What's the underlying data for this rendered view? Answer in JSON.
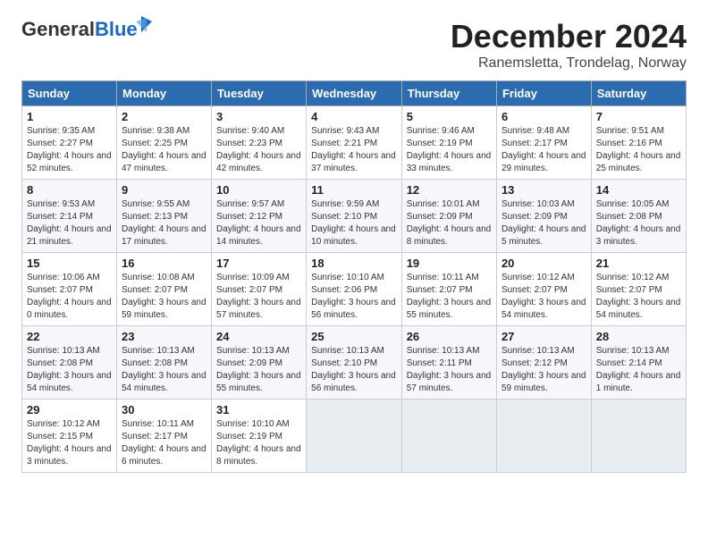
{
  "header": {
    "logo_line1": "General",
    "logo_line2": "Blue",
    "title": "December 2024",
    "subtitle": "Ranemsletta, Trondelag, Norway"
  },
  "calendar": {
    "days_of_week": [
      "Sunday",
      "Monday",
      "Tuesday",
      "Wednesday",
      "Thursday",
      "Friday",
      "Saturday"
    ],
    "weeks": [
      [
        {
          "day": "",
          "info": ""
        },
        {
          "day": "2",
          "info": "Sunrise: 9:38 AM\nSunset: 2:25 PM\nDaylight: 4 hours\nand 47 minutes."
        },
        {
          "day": "3",
          "info": "Sunrise: 9:40 AM\nSunset: 2:23 PM\nDaylight: 4 hours\nand 42 minutes."
        },
        {
          "day": "4",
          "info": "Sunrise: 9:43 AM\nSunset: 2:21 PM\nDaylight: 4 hours\nand 37 minutes."
        },
        {
          "day": "5",
          "info": "Sunrise: 9:46 AM\nSunset: 2:19 PM\nDaylight: 4 hours\nand 33 minutes."
        },
        {
          "day": "6",
          "info": "Sunrise: 9:48 AM\nSunset: 2:17 PM\nDaylight: 4 hours\nand 29 minutes."
        },
        {
          "day": "7",
          "info": "Sunrise: 9:51 AM\nSunset: 2:16 PM\nDaylight: 4 hours\nand 25 minutes."
        }
      ],
      [
        {
          "day": "8",
          "info": "Sunrise: 9:53 AM\nSunset: 2:14 PM\nDaylight: 4 hours\nand 21 minutes."
        },
        {
          "day": "9",
          "info": "Sunrise: 9:55 AM\nSunset: 2:13 PM\nDaylight: 4 hours\nand 17 minutes."
        },
        {
          "day": "10",
          "info": "Sunrise: 9:57 AM\nSunset: 2:12 PM\nDaylight: 4 hours\nand 14 minutes."
        },
        {
          "day": "11",
          "info": "Sunrise: 9:59 AM\nSunset: 2:10 PM\nDaylight: 4 hours\nand 10 minutes."
        },
        {
          "day": "12",
          "info": "Sunrise: 10:01 AM\nSunset: 2:09 PM\nDaylight: 4 hours\nand 8 minutes."
        },
        {
          "day": "13",
          "info": "Sunrise: 10:03 AM\nSunset: 2:09 PM\nDaylight: 4 hours\nand 5 minutes."
        },
        {
          "day": "14",
          "info": "Sunrise: 10:05 AM\nSunset: 2:08 PM\nDaylight: 4 hours\nand 3 minutes."
        }
      ],
      [
        {
          "day": "15",
          "info": "Sunrise: 10:06 AM\nSunset: 2:07 PM\nDaylight: 4 hours\nand 0 minutes."
        },
        {
          "day": "16",
          "info": "Sunrise: 10:08 AM\nSunset: 2:07 PM\nDaylight: 3 hours\nand 59 minutes."
        },
        {
          "day": "17",
          "info": "Sunrise: 10:09 AM\nSunset: 2:07 PM\nDaylight: 3 hours\nand 57 minutes."
        },
        {
          "day": "18",
          "info": "Sunrise: 10:10 AM\nSunset: 2:06 PM\nDaylight: 3 hours\nand 56 minutes."
        },
        {
          "day": "19",
          "info": "Sunrise: 10:11 AM\nSunset: 2:07 PM\nDaylight: 3 hours\nand 55 minutes."
        },
        {
          "day": "20",
          "info": "Sunrise: 10:12 AM\nSunset: 2:07 PM\nDaylight: 3 hours\nand 54 minutes."
        },
        {
          "day": "21",
          "info": "Sunrise: 10:12 AM\nSunset: 2:07 PM\nDaylight: 3 hours\nand 54 minutes."
        }
      ],
      [
        {
          "day": "22",
          "info": "Sunrise: 10:13 AM\nSunset: 2:08 PM\nDaylight: 3 hours\nand 54 minutes."
        },
        {
          "day": "23",
          "info": "Sunrise: 10:13 AM\nSunset: 2:08 PM\nDaylight: 3 hours\nand 54 minutes."
        },
        {
          "day": "24",
          "info": "Sunrise: 10:13 AM\nSunset: 2:09 PM\nDaylight: 3 hours\nand 55 minutes."
        },
        {
          "day": "25",
          "info": "Sunrise: 10:13 AM\nSunset: 2:10 PM\nDaylight: 3 hours\nand 56 minutes."
        },
        {
          "day": "26",
          "info": "Sunrise: 10:13 AM\nSunset: 2:11 PM\nDaylight: 3 hours\nand 57 minutes."
        },
        {
          "day": "27",
          "info": "Sunrise: 10:13 AM\nSunset: 2:12 PM\nDaylight: 3 hours\nand 59 minutes."
        },
        {
          "day": "28",
          "info": "Sunrise: 10:13 AM\nSunset: 2:14 PM\nDaylight: 4 hours\nand 1 minute."
        }
      ],
      [
        {
          "day": "29",
          "info": "Sunrise: 10:12 AM\nSunset: 2:15 PM\nDaylight: 4 hours\nand 3 minutes."
        },
        {
          "day": "30",
          "info": "Sunrise: 10:11 AM\nSunset: 2:17 PM\nDaylight: 4 hours\nand 6 minutes."
        },
        {
          "day": "31",
          "info": "Sunrise: 10:10 AM\nSunset: 2:19 PM\nDaylight: 4 hours\nand 8 minutes."
        },
        {
          "day": "",
          "info": ""
        },
        {
          "day": "",
          "info": ""
        },
        {
          "day": "",
          "info": ""
        },
        {
          "day": "",
          "info": ""
        }
      ]
    ],
    "week1_sunday": {
      "day": "1",
      "info": "Sunrise: 9:35 AM\nSunset: 2:27 PM\nDaylight: 4 hours\nand 52 minutes."
    }
  }
}
